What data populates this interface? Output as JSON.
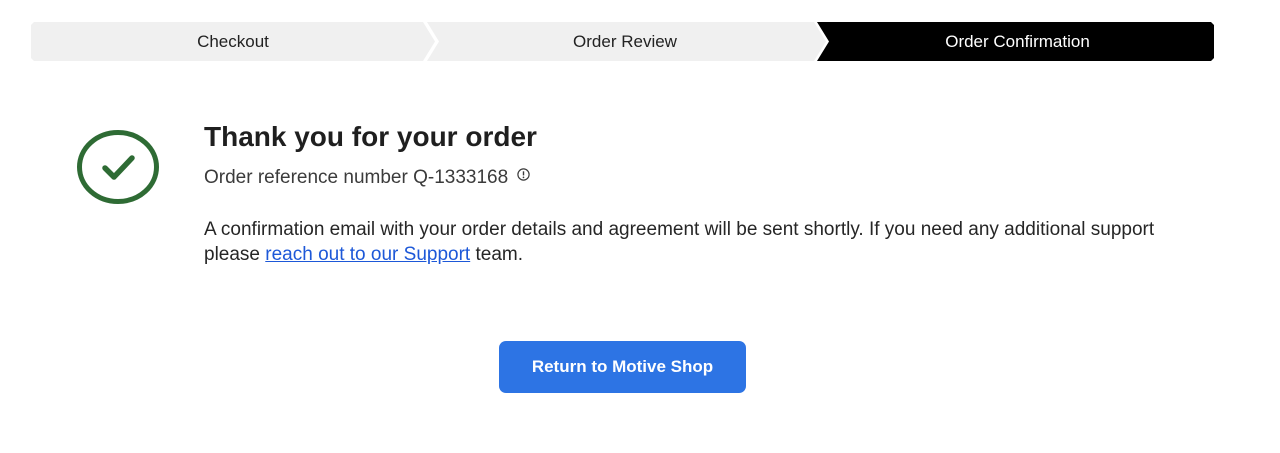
{
  "stepper": {
    "steps": [
      {
        "label": "Checkout"
      },
      {
        "label": "Order Review"
      },
      {
        "label": "Order Confirmation"
      }
    ],
    "active_index": 2
  },
  "confirmation": {
    "title": "Thank you for your order",
    "reference_label": "Order reference number Q-1333168",
    "message_before": "A confirmation email with your order details and agreement will be sent shortly. If you need any additional support please ",
    "support_link": "reach out to our Support",
    "message_after": " team."
  },
  "actions": {
    "return_button": "Return to Motive Shop"
  },
  "colors": {
    "check": "#2e6b34",
    "link": "#1d58d8",
    "button": "#2d74e4",
    "active_step": "#000000",
    "inactive_step": "#f0f0f0"
  },
  "icons": {
    "status": "check-circle-icon",
    "info": "info-icon"
  }
}
